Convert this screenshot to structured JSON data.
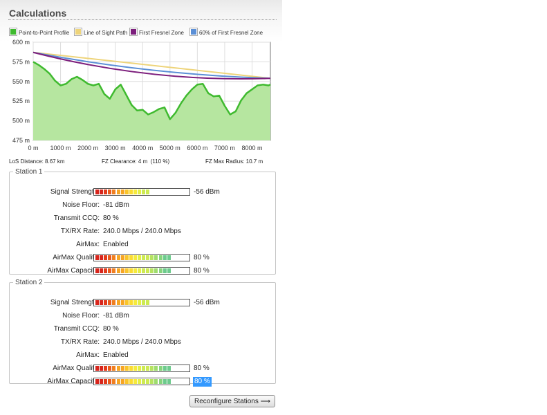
{
  "section_title": "Calculations",
  "legend": [
    {
      "label": "Point-to-Point Profile",
      "color": "#3fba2f"
    },
    {
      "label": "Line of Sight Path",
      "color": "#eed47a"
    },
    {
      "label": "First Fresnel Zone",
      "color": "#7d1f7d"
    },
    {
      "label": "60% of First Fresnel Zone",
      "color": "#5b8fd6"
    }
  ],
  "chart_data": {
    "type": "area",
    "y_ticks": [
      "600 m",
      "575 m",
      "550 m",
      "525 m",
      "500 m",
      "475 m"
    ],
    "x_ticks": [
      "0 m",
      "1000 m",
      "2000 m",
      "3000 m",
      "4000 m",
      "5000 m",
      "6000 m",
      "7000 m",
      "8000 m"
    ],
    "xlim": [
      0,
      8670
    ],
    "ylim": [
      475,
      600
    ],
    "grid": true,
    "series": [
      {
        "name": "Point-to-Point Profile",
        "x": [
          0,
          200,
          400,
          600,
          800,
          1000,
          1200,
          1400,
          1600,
          1800,
          2000,
          2200,
          2400,
          2600,
          2800,
          3000,
          3200,
          3400,
          3600,
          3800,
          4000,
          4200,
          4400,
          4600,
          4800,
          5000,
          5200,
          5400,
          5600,
          5800,
          6000,
          6200,
          6400,
          6600,
          6800,
          7000,
          7200,
          7400,
          7600,
          7800,
          8000,
          8200,
          8400,
          8600,
          8670
        ],
        "y": [
          575,
          571,
          566,
          560,
          551,
          545,
          547,
          553,
          556,
          552,
          547,
          545,
          547,
          534,
          528,
          540,
          546,
          533,
          520,
          513,
          514,
          508,
          511,
          515,
          517,
          502,
          510,
          522,
          532,
          540,
          546,
          547,
          535,
          531,
          532,
          519,
          508,
          512,
          526,
          535,
          540,
          545,
          546,
          545,
          546
        ]
      },
      {
        "name": "Line of Sight Path",
        "x": [
          0,
          8670
        ],
        "y": [
          587,
          554
        ]
      },
      {
        "name": "First Fresnel Zone",
        "x": [
          0,
          8670
        ],
        "y": [
          587,
          554
        ],
        "clearance_depth": 11
      },
      {
        "name": "60% of First Fresnel Zone",
        "x": [
          0,
          8670
        ],
        "y": [
          587,
          554
        ],
        "clearance_depth": 6
      }
    ]
  },
  "summary": {
    "los_distance": "LoS Distance: 8.67 km",
    "fz_clearance": "FZ Clearance: 4 m  (110 %)",
    "fz_max_radius": "FZ Max Radius: 10.7 m"
  },
  "stations": [
    {
      "title": "Station 1",
      "signal_label": "Signal Strength:",
      "signal_value": "-56 dBm",
      "signal_level": 0.6,
      "noise_label": "Noise Floor:",
      "noise_value": "-81 dBm",
      "ccq_label": "Transmit CCQ:",
      "ccq_value": "80 %",
      "rate_label": "TX/RX Rate:",
      "rate_value": "240.0 Mbps / 240.0 Mbps",
      "airmax_label": "AirMax:",
      "airmax_value": "Enabled",
      "quality_label": "AirMax Quality:",
      "quality_value": "80 %",
      "quality_level": 0.8,
      "capacity_label": "AirMax Capacity:",
      "capacity_value": "80 %",
      "capacity_level": 0.8
    },
    {
      "title": "Station 2",
      "signal_label": "Signal Strength:",
      "signal_value": "-56 dBm",
      "signal_level": 0.6,
      "noise_label": "Noise Floor:",
      "noise_value": "-81 dBm",
      "ccq_label": "Transmit CCQ:",
      "ccq_value": "80 %",
      "rate_label": "TX/RX Rate:",
      "rate_value": "240.0 Mbps / 240.0 Mbps",
      "airmax_label": "AirMax:",
      "airmax_value": "Enabled",
      "quality_label": "AirMax Quality:",
      "quality_value": "80 %",
      "quality_level": 0.8,
      "capacity_label": "AirMax Capacity:",
      "capacity_value": "80 %",
      "capacity_level": 0.8
    }
  ],
  "meter_colors": [
    "#d8261d",
    "#e23b1c",
    "#ea5a1d",
    "#f07f20",
    "#f6a524",
    "#f9c52a",
    "#fbdb31",
    "#f6ea3b",
    "#e4ef45",
    "#cdea52",
    "#b6e360",
    "#9edc6e",
    "#86d47d",
    "#6dcb8d",
    "#54c29e",
    "#3ebbae",
    "#2fb3bb",
    "#26aac4"
  ],
  "reconfigure_label": "Reconfigure Stations ⟶"
}
